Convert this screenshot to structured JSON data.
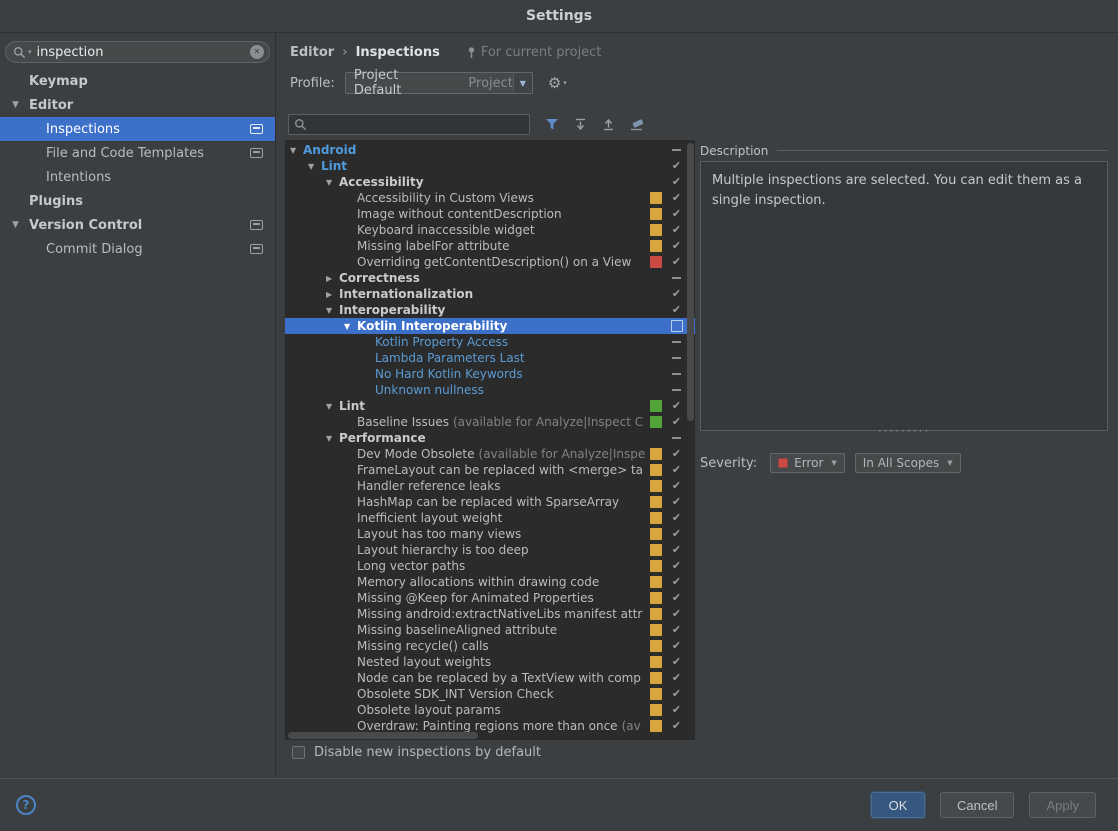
{
  "colors": {
    "selection": "#3d70c9",
    "group_blue": "#4e9bdd",
    "link_blue": "#5b9bd5",
    "badge_yellow": "#d9a63e",
    "badge_red": "#cb4a43",
    "badge_green": "#53a538"
  },
  "icons": {
    "gear": "⚙",
    "caret": "▼",
    "mini_caret": "▾",
    "clear": "✕",
    "help": "?",
    "check": "✔",
    "arrow_down": "▼",
    "arrow_right": "▶",
    "splitter_dots": "·········"
  },
  "titlebar": {
    "title": "Settings"
  },
  "sidebar": {
    "search": {
      "value": "inspection"
    },
    "items": [
      {
        "label": "Keymap",
        "level": 0,
        "arrow": "none",
        "bold": true
      },
      {
        "label": "Editor",
        "level": 0,
        "arrow": "down",
        "bold": true
      },
      {
        "label": "Inspections",
        "level": 1,
        "arrow": "none",
        "selected": true,
        "project_icon": true
      },
      {
        "label": "File and Code Templates",
        "level": 1,
        "arrow": "none",
        "project_icon": true
      },
      {
        "label": "Intentions",
        "level": 1,
        "arrow": "none"
      },
      {
        "label": "Plugins",
        "level": 0,
        "arrow": "none",
        "bold": true
      },
      {
        "label": "Version Control",
        "level": 0,
        "arrow": "down",
        "bold": true,
        "project_icon": true
      },
      {
        "label": "Commit Dialog",
        "level": 1,
        "arrow": "none",
        "project_icon": true
      }
    ]
  },
  "header": {
    "breadcrumb": [
      "Editor",
      "Inspections"
    ],
    "separator": "›",
    "context_label": "For current project",
    "profile_label": "Profile:",
    "profile_value": "Project Default",
    "profile_hint": "Project"
  },
  "toolbar": {
    "search_value": ""
  },
  "tree": {
    "rows": [
      {
        "label": "Android",
        "level": 0,
        "arrow": "down",
        "style": "blue",
        "check": "dash"
      },
      {
        "label": "Lint",
        "level": 1,
        "arrow": "down",
        "style": "blue",
        "check": "check"
      },
      {
        "label": "Accessibility",
        "level": 2,
        "arrow": "down",
        "style": "bold",
        "check": "check"
      },
      {
        "label": "Accessibility in Custom Views",
        "level": 3,
        "style": "plain",
        "badge": "yellow",
        "check": "check"
      },
      {
        "label": "Image without contentDescription",
        "level": 3,
        "style": "plain",
        "badge": "yellow",
        "check": "check"
      },
      {
        "label": "Keyboard inaccessible widget",
        "level": 3,
        "style": "plain",
        "badge": "yellow",
        "check": "check"
      },
      {
        "label": "Missing labelFor attribute",
        "level": 3,
        "style": "plain",
        "badge": "yellow",
        "check": "check"
      },
      {
        "label": "Overriding getContentDescription() on a View",
        "level": 3,
        "style": "plain",
        "badge": "red",
        "check": "check"
      },
      {
        "label": "Correctness",
        "level": 2,
        "arrow": "right",
        "style": "bold",
        "check": "dash"
      },
      {
        "label": "Internationalization",
        "level": 2,
        "arrow": "right",
        "style": "bold",
        "check": "check"
      },
      {
        "label": "Interoperability",
        "level": 2,
        "arrow": "down",
        "style": "bold",
        "check": "check"
      },
      {
        "label": "Kotlin Interoperability",
        "level": 3,
        "arrow": "down",
        "style": "bold",
        "check": "empty",
        "selected": true
      },
      {
        "label": "Kotlin Property Access",
        "level": 4,
        "style": "link",
        "check": "dash"
      },
      {
        "label": "Lambda Parameters Last",
        "level": 4,
        "style": "link",
        "check": "dash"
      },
      {
        "label": "No Hard Kotlin Keywords",
        "level": 4,
        "style": "link",
        "check": "dash"
      },
      {
        "label": "Unknown nullness",
        "level": 4,
        "style": "link",
        "check": "dash"
      },
      {
        "label": "Lint",
        "level": 2,
        "arrow": "down",
        "style": "bold",
        "badge": "green",
        "check": "check"
      },
      {
        "label": "Baseline Issues",
        "dim": "(available for Analyze|Inspect C",
        "level": 3,
        "style": "plain",
        "badge": "green",
        "check": "check"
      },
      {
        "label": "Performance",
        "level": 2,
        "arrow": "down",
        "style": "bold",
        "check": "dash"
      },
      {
        "label": "Dev Mode Obsolete",
        "dim": "(available for Analyze|Inspe",
        "level": 3,
        "style": "plain",
        "badge": "yellow",
        "check": "check"
      },
      {
        "label": "FrameLayout can be replaced with <merge> ta",
        "level": 3,
        "style": "plain",
        "badge": "yellow",
        "check": "check"
      },
      {
        "label": "Handler reference leaks",
        "level": 3,
        "style": "plain",
        "badge": "yellow",
        "check": "check"
      },
      {
        "label": "HashMap can be replaced with SparseArray",
        "level": 3,
        "style": "plain",
        "badge": "yellow",
        "check": "check"
      },
      {
        "label": "Inefficient layout weight",
        "level": 3,
        "style": "plain",
        "badge": "yellow",
        "check": "check"
      },
      {
        "label": "Layout has too many views",
        "level": 3,
        "style": "plain",
        "badge": "yellow",
        "check": "check"
      },
      {
        "label": "Layout hierarchy is too deep",
        "level": 3,
        "style": "plain",
        "badge": "yellow",
        "check": "check"
      },
      {
        "label": "Long vector paths",
        "level": 3,
        "style": "plain",
        "badge": "yellow",
        "check": "check"
      },
      {
        "label": "Memory allocations within drawing code",
        "level": 3,
        "style": "plain",
        "badge": "yellow",
        "check": "check"
      },
      {
        "label": "Missing @Keep for Animated Properties",
        "level": 3,
        "style": "plain",
        "badge": "yellow",
        "check": "check"
      },
      {
        "label": "Missing android:extractNativeLibs manifest attr",
        "level": 3,
        "style": "plain",
        "badge": "yellow",
        "check": "check"
      },
      {
        "label": "Missing baselineAligned attribute",
        "level": 3,
        "style": "plain",
        "badge": "yellow",
        "check": "check"
      },
      {
        "label": "Missing recycle() calls",
        "level": 3,
        "style": "plain",
        "badge": "yellow",
        "check": "check"
      },
      {
        "label": "Nested layout weights",
        "level": 3,
        "style": "plain",
        "badge": "yellow",
        "check": "check"
      },
      {
        "label": "Node can be replaced by a TextView with comp",
        "level": 3,
        "style": "plain",
        "badge": "yellow",
        "check": "check"
      },
      {
        "label": "Obsolete SDK_INT Version Check",
        "level": 3,
        "style": "plain",
        "badge": "yellow",
        "check": "check"
      },
      {
        "label": "Obsolete layout params",
        "level": 3,
        "style": "plain",
        "badge": "yellow",
        "check": "check"
      },
      {
        "label": "Overdraw: Painting regions more than once",
        "dim": "(av",
        "level": 3,
        "style": "plain",
        "badge": "yellow",
        "check": "check"
      }
    ]
  },
  "description": {
    "title": "Description",
    "text": "Multiple inspections are selected. You can edit them as a single inspection."
  },
  "severity": {
    "label": "Severity:",
    "value": "Error",
    "scope": "In All Scopes"
  },
  "footer": {
    "disable_label": "Disable new inspections by default"
  },
  "buttons": {
    "ok": "OK",
    "cancel": "Cancel",
    "apply": "Apply"
  }
}
